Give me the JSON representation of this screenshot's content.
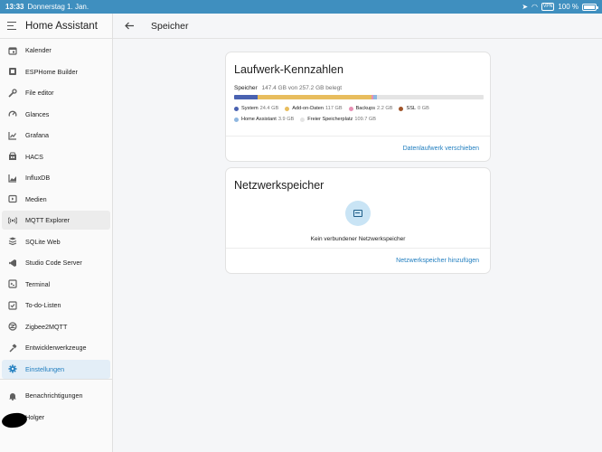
{
  "statusbar": {
    "time": "13:33",
    "date": "Donnerstag 1. Jan.",
    "vpn": "VPN",
    "battery": "100 %"
  },
  "sidebar": {
    "app_title": "Home Assistant",
    "items": [
      {
        "label": "Kalender",
        "icon": "calendar-icon"
      },
      {
        "label": "ESPHome Builder",
        "icon": "esphome-icon"
      },
      {
        "label": "File editor",
        "icon": "wrench-icon"
      },
      {
        "label": "Glances",
        "icon": "gauge-icon"
      },
      {
        "label": "Grafana",
        "icon": "chart-icon"
      },
      {
        "label": "HACS",
        "icon": "hacs-icon"
      },
      {
        "label": "InfluxDB",
        "icon": "chart-areaspline-icon"
      },
      {
        "label": "Medien",
        "icon": "media-icon"
      },
      {
        "label": "MQTT Explorer",
        "icon": "broadcast-icon"
      },
      {
        "label": "SQLite Web",
        "icon": "database-icon"
      },
      {
        "label": "Studio Code Server",
        "icon": "vscode-icon"
      },
      {
        "label": "Terminal",
        "icon": "console-icon"
      },
      {
        "label": "To-do-Listen",
        "icon": "checklist-icon"
      },
      {
        "label": "Zigbee2MQTT",
        "icon": "zigbee-icon"
      },
      {
        "label": "Entwicklerwerkzeuge",
        "icon": "hammer-icon"
      },
      {
        "label": "Einstellungen",
        "icon": "gear-icon"
      }
    ],
    "notifications_label": "Benachrichtigungen",
    "user_label": "Holger"
  },
  "header": {
    "title": "Speicher"
  },
  "disk_card": {
    "title": "Laufwerk-Kennzahlen",
    "storage_label": "Speicher",
    "storage_value": "147.4 GB von 257.2 GB belegt",
    "used_gb": 147.4,
    "total_gb": 257.2,
    "segments": [
      {
        "name": "System",
        "value": "24.4 GB",
        "gb": 24.4,
        "color": "#4a62b1"
      },
      {
        "name": "Add-on-Daten",
        "value": "117 GB",
        "gb": 117,
        "color": "#e8bd5e"
      },
      {
        "name": "Backups",
        "value": "2.2 GB",
        "gb": 2.2,
        "color": "#e790b4"
      },
      {
        "name": "SSL",
        "value": "0 GB",
        "gb": 0,
        "color": "#a0542a"
      },
      {
        "name": "Home Assistant",
        "value": "3.9 GB",
        "gb": 3.9,
        "color": "#8fb7e0"
      },
      {
        "name": "Freier Speicherplatz",
        "value": "109.7 GB",
        "gb": 109.7,
        "color": "#e4e4e4"
      }
    ],
    "action_label": "Datenlaufwerk verschieben"
  },
  "network_card": {
    "title": "Netzwerkspeicher",
    "empty_text": "Kein verbundener Netzwerkspeicher",
    "action_label": "Netzwerkspeicher hinzufügen"
  }
}
